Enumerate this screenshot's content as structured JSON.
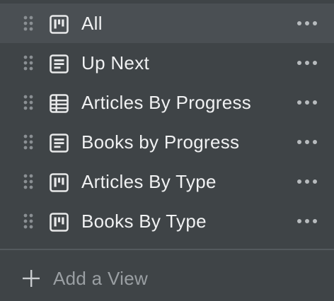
{
  "views": [
    {
      "label": "All",
      "icon": "board-icon",
      "active": true
    },
    {
      "label": "Up Next",
      "icon": "list-icon",
      "active": false
    },
    {
      "label": "Articles By Progress",
      "icon": "table-icon",
      "active": false
    },
    {
      "label": "Books by Progress",
      "icon": "list-icon",
      "active": false
    },
    {
      "label": "Articles By Type",
      "icon": "board-icon",
      "active": false
    },
    {
      "label": "Books By Type",
      "icon": "board-icon",
      "active": false
    }
  ],
  "add_view": {
    "label": "Add a View",
    "icon": "plus-icon"
  },
  "colors": {
    "background": "#3f4447",
    "active_row": "#4a4f53",
    "text": "#f0f1f2",
    "muted_text": "#9a9fa3",
    "icon": "#e8e9ea",
    "handle": "#8a8f93"
  }
}
